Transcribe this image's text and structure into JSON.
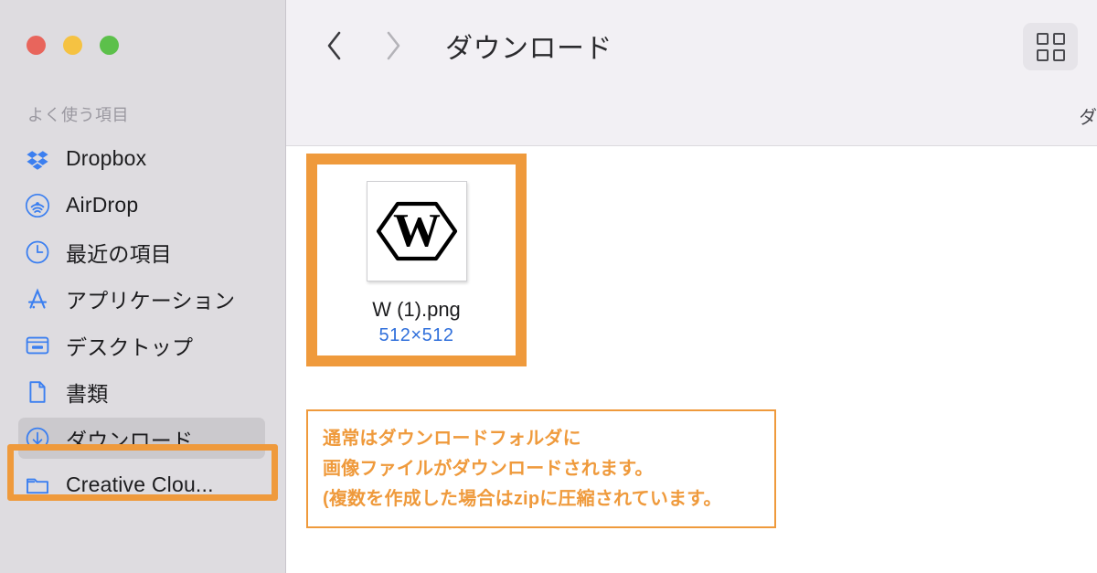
{
  "window": {
    "title": "ダウンロード",
    "traffic_lights": [
      {
        "name": "close",
        "color": "#e8655c"
      },
      {
        "name": "minimize",
        "color": "#f5c242"
      },
      {
        "name": "maximize",
        "color": "#5cc04b"
      }
    ]
  },
  "sidebar": {
    "section_title": "よく使う項目",
    "items": [
      {
        "label": "Dropbox",
        "icon": "dropbox-icon",
        "selected": false
      },
      {
        "label": "AirDrop",
        "icon": "airdrop-icon",
        "selected": false
      },
      {
        "label": "最近の項目",
        "icon": "clock-icon",
        "selected": false
      },
      {
        "label": "アプリケーション",
        "icon": "app-store-icon",
        "selected": false
      },
      {
        "label": "デスクトップ",
        "icon": "desktop-icon",
        "selected": false
      },
      {
        "label": "書類",
        "icon": "document-icon",
        "selected": false
      },
      {
        "label": "ダウンロード",
        "icon": "download-icon",
        "selected": true
      },
      {
        "label": "Creative Clou...",
        "icon": "folder-icon",
        "selected": false
      }
    ]
  },
  "toolbar": {
    "back_label": "戻る",
    "forward_label": "進む",
    "back_icon": "chevron-left-icon",
    "forward_icon": "chevron-right-icon",
    "back_enabled": true,
    "forward_enabled": false,
    "view_button_icon": "grid-view-icon",
    "view_button_label": "表示"
  },
  "pathbar": {
    "fragment": "ダ"
  },
  "files": [
    {
      "name": "W (1).png",
      "dimensions": "512×512",
      "thumbnail": "hexagon-w-logo",
      "selected": true
    }
  ],
  "annotation": {
    "lines": [
      "通常はダウンロードフォルダに",
      "画像ファイルがダウンロードされます。",
      "(複数を作成した場合はzipに圧縮されています。"
    ]
  },
  "colors": {
    "highlight_orange": "#ef9a3c",
    "sidebar_bg": "#dedce0",
    "toolbar_bg": "#f2f0f4",
    "accent_blue": "#2f6fdb",
    "sidebar_icon_blue": "#3b7ff0"
  }
}
